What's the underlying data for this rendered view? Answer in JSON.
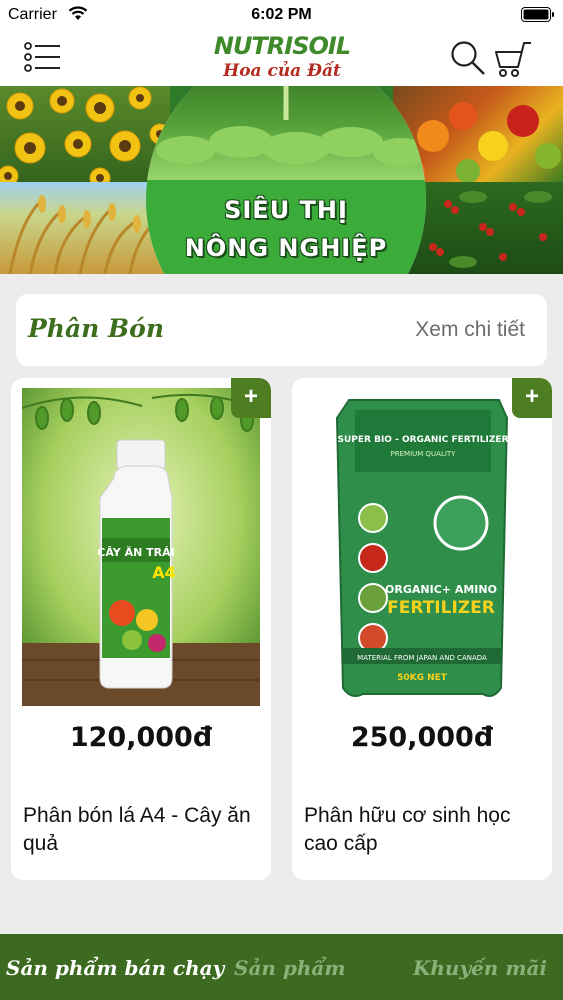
{
  "status_bar": {
    "carrier": "Carrier",
    "time": "6:02 PM"
  },
  "header": {
    "logo_text": "NUTRISOIL",
    "logo_tagline": "Hoa của Đất",
    "icons": [
      "menu-icon",
      "search-icon",
      "cart-icon"
    ]
  },
  "banner": {
    "title": "SIÊU THỊ",
    "subtitle": "NÔNG NGHIỆP"
  },
  "section": {
    "title": "Phân Bón",
    "link_label": "Xem chi tiết"
  },
  "products": [
    {
      "add_label": "+",
      "price": "120,000đ",
      "name": "Phân bón lá A4 - Cây ăn quả",
      "image_text": "CÂY ĂN TRÁI A4"
    },
    {
      "add_label": "+",
      "price": "250,000đ",
      "name": "Phân hữu cơ sinh học cao cấp",
      "image_text": "ORGANIC+ AMINO FERTILIZER"
    }
  ],
  "tabs": [
    {
      "label": "Sản phẩm bán chạy",
      "active": true
    },
    {
      "label": "Sản phẩm",
      "active": false
    },
    {
      "label": "Khuyến mãi",
      "active": false
    }
  ],
  "colors": {
    "brand_green": "#3c6a21",
    "tab_inactive": "#8bb07a",
    "logo_red": "#b52a1e",
    "background": "#ececec"
  }
}
